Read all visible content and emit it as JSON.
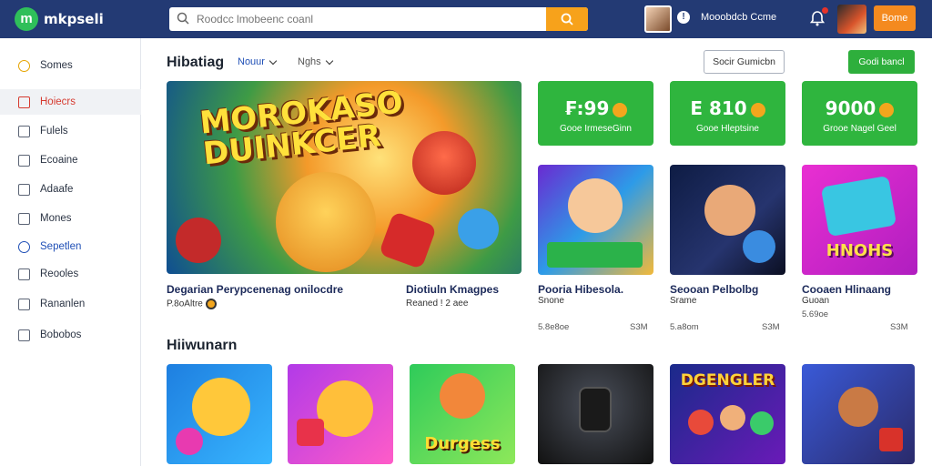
{
  "header": {
    "brand": "mkpseli",
    "logo_letter": "m",
    "search": {
      "placeholder": "Roodcc lmobeenc coanl"
    },
    "user_name": "Mooobdcb Ccme",
    "signin_label": "Bome"
  },
  "sidebar": {
    "items": [
      {
        "label": "Somes",
        "icon": "coin-icon"
      },
      {
        "label": "Hoiecrs",
        "icon": "flag-icon"
      },
      {
        "label": "Fulels",
        "icon": "home-icon"
      },
      {
        "label": "Ecoaine",
        "icon": "image-icon"
      },
      {
        "label": "Adaafe",
        "icon": "tag-icon"
      },
      {
        "label": "Mones",
        "icon": "calendar-icon"
      },
      {
        "label": "Sepetlen",
        "icon": "gamepad-icon"
      },
      {
        "label": "Reooles",
        "icon": "list-icon"
      },
      {
        "label": "Rananlen",
        "icon": "pencil-icon"
      },
      {
        "label": "Bobobos",
        "icon": "box-icon"
      }
    ]
  },
  "section1": {
    "title": "Hibatiag",
    "tabs": [
      "Nouur",
      "Nghs"
    ],
    "outline_button": "Socir Gumicbn",
    "green_button": "Godi bancl"
  },
  "hero": {
    "title_line1": "MOROKASO",
    "title_line2": "DUINKCER",
    "caption": "Degarian Perypcenenag onilocdre",
    "sub": "P.8oAltre",
    "caption2": "Diotiuln Kmagpes",
    "sub2": "Reaned ! 2 aee"
  },
  "stats": [
    {
      "value": "₣:99",
      "label": "Gooe IrmeseGinn"
    },
    {
      "value": "E 810",
      "label": "Gooe Hleptsine"
    },
    {
      "value": "9000",
      "label": "Grooe Nagel Geel"
    }
  ],
  "cards": [
    {
      "title": "Pooria Hibesola.",
      "sub": "Snone",
      "size": "5.8e8oe",
      "mem": "S3M"
    },
    {
      "title": "Seooan Pelbolbg",
      "sub": "Srame",
      "size": "5.a8om",
      "mem": "S3M"
    },
    {
      "title": "Cooaen Hlinaang",
      "sub": "Guoan",
      "size": "5.69oe",
      "mem": "S3M"
    }
  ],
  "card3_text": "HNOHS",
  "section2": {
    "title": "Hiiwunarn",
    "thumbs": [
      {
        "text": ""
      },
      {
        "text": ""
      },
      {
        "text": "Durgess"
      },
      {
        "text": ""
      },
      {
        "text": "DGENGLER"
      },
      {
        "text": ""
      }
    ]
  },
  "colors": {
    "topbar": "#233a74",
    "accent_orange": "#f48a1f",
    "green": "#2fb53e",
    "active_red": "#d63a2f"
  }
}
